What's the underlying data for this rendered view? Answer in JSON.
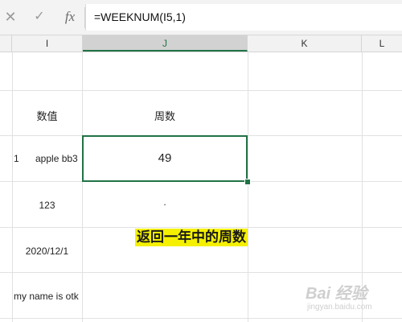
{
  "formula_bar": {
    "cancel_icon": "close-icon",
    "enter_icon": "check-icon",
    "function_label": "fx",
    "formula": "=WEEKNUM(I5,1)"
  },
  "columns": [
    {
      "label": "I"
    },
    {
      "label": "J",
      "selected": true
    },
    {
      "label": "K"
    },
    {
      "label": "L"
    }
  ],
  "cells": {
    "i_header": "数值",
    "j_header": "周数",
    "row_marker": "1",
    "i_text": "apple bb3",
    "j_result": "49",
    "j_dot": ".",
    "i_number": "123",
    "i_date": "2020/12/1",
    "i_text2": "my name is otk"
  },
  "annotation": "返回一年中的周数",
  "watermark": {
    "main": "Bai 经验",
    "sub": "jingyan.baidu.com"
  },
  "colors": {
    "accent": "#217346",
    "highlight": "#f4f000"
  }
}
